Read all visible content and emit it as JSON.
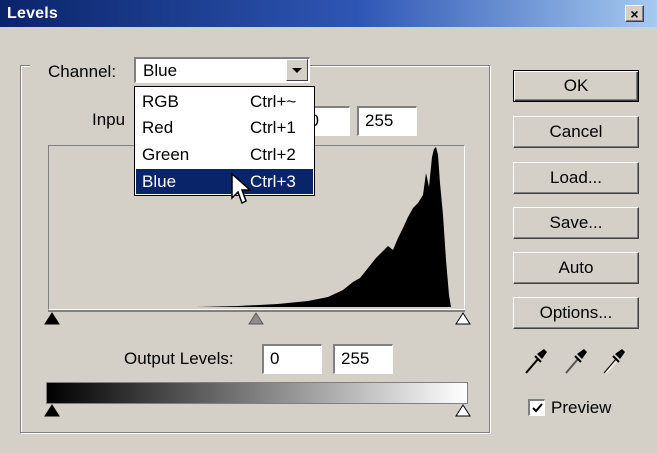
{
  "window": {
    "title": "Levels",
    "close_glyph": "×"
  },
  "channel": {
    "label": "Channel:",
    "selected_value": "Blue",
    "options": [
      {
        "label": "RGB",
        "shortcut": "Ctrl+~"
      },
      {
        "label": "Red",
        "shortcut": "Ctrl+1"
      },
      {
        "label": "Green",
        "shortcut": "Ctrl+2"
      },
      {
        "label": "Blue",
        "shortcut": "Ctrl+3",
        "selected": true
      }
    ]
  },
  "input_levels": {
    "label": "Inpu",
    "mid_value": "00",
    "high_value": "255"
  },
  "output_levels": {
    "label": "Output Levels:",
    "low_value": "0",
    "high_value": "255"
  },
  "buttons": {
    "ok": "OK",
    "cancel": "Cancel",
    "load": "Load...",
    "save": "Save...",
    "auto": "Auto",
    "options": "Options..."
  },
  "preview": {
    "label": "Preview",
    "checked": true
  },
  "icons": {
    "black_point": "eyedropper-black-icon",
    "gray_point": "eyedropper-gray-icon",
    "white_point": "eyedropper-white-icon"
  },
  "colors": {
    "title_bar": "#0a246a",
    "selection": "#0a246a",
    "face": "#d4d0c8"
  }
}
